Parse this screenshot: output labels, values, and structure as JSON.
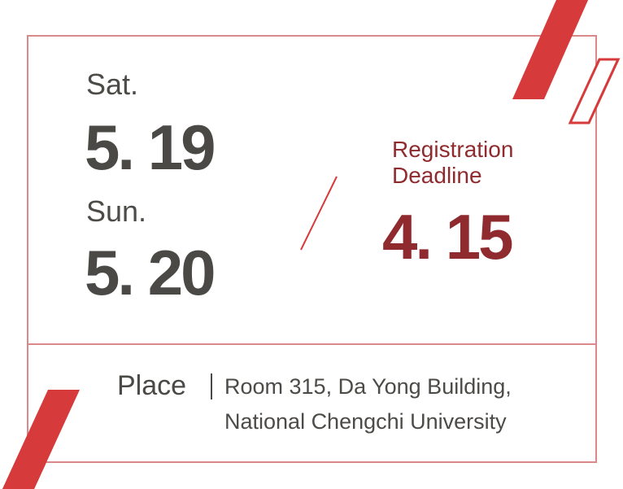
{
  "colors": {
    "accent_red": "#d63a3a",
    "dark_red": "#8f2b2e",
    "frame_line": "#d9898a",
    "text_gray": "#4b4946"
  },
  "dates": [
    {
      "day": "Sat.",
      "date": "5. 19"
    },
    {
      "day": "Sun.",
      "date": "5. 20"
    }
  ],
  "registration": {
    "label_line1": "Registration",
    "label_line2": "Deadline",
    "date": "4. 15"
  },
  "place": {
    "label": "Place",
    "line1": "Room 315, Da Yong Building,",
    "line2": "National Chengchi University"
  }
}
